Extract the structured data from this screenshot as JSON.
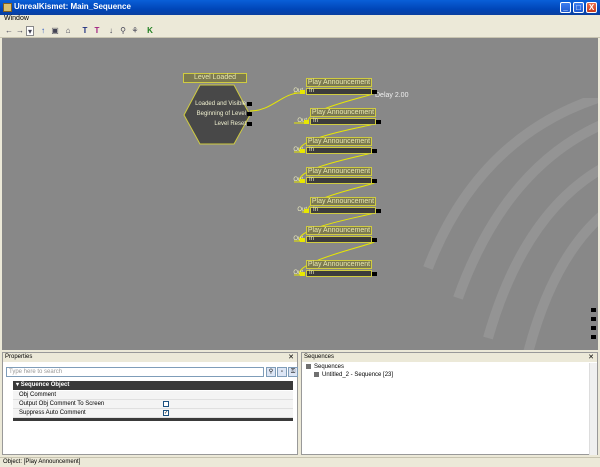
{
  "window": {
    "title": "UnrealKismet: Main_Sequence",
    "minimize": "_",
    "maximize": "□",
    "close": "X"
  },
  "menu": {
    "items": [
      "Window"
    ]
  },
  "toolbar": {
    "icons": [
      "←",
      "→",
      "▾",
      "↑",
      "▣",
      "⌂",
      "T",
      "T",
      "↓",
      "⚲",
      "⚘",
      "K"
    ]
  },
  "canvas": {
    "event_node": {
      "title": "Level Loaded",
      "outputs": [
        "Loaded and Visible",
        "Beginning of Level",
        "Level Reset"
      ]
    },
    "delay_label": "Delay 2.00",
    "action_nodes": [
      {
        "title": "Play Announcement",
        "in": "In",
        "out": "Out"
      },
      {
        "title": "Play Announcement",
        "in": "In",
        "out": "Out"
      },
      {
        "title": "Play Announcement",
        "in": "In",
        "out": "Out"
      },
      {
        "title": "Play Announcement",
        "in": "In",
        "out": "Out"
      },
      {
        "title": "Play Announcement",
        "in": "In",
        "out": "Out"
      },
      {
        "title": "Play Announcement",
        "in": "In",
        "out": "Out"
      },
      {
        "title": "Play Announcement",
        "in": "In",
        "out": "Out"
      }
    ]
  },
  "properties": {
    "title": "Properties",
    "search_placeholder": "Type here to search",
    "category": "Sequence Object",
    "rows": [
      {
        "label": "Obj Comment",
        "checked": null
      },
      {
        "label": "Output Obj Comment To Screen",
        "checked": false
      },
      {
        "label": "Suppress Auto Comment",
        "checked": true
      }
    ]
  },
  "sequences": {
    "title": "Sequences",
    "root": "Sequences",
    "child": "Untitled_2 - Sequence [23]"
  },
  "status": "Object: [Play Announcement]",
  "colors": {
    "canvas": "#888888",
    "node_border": "#d0cc40",
    "wire": "#e8e800",
    "header": "#7c7a50"
  }
}
